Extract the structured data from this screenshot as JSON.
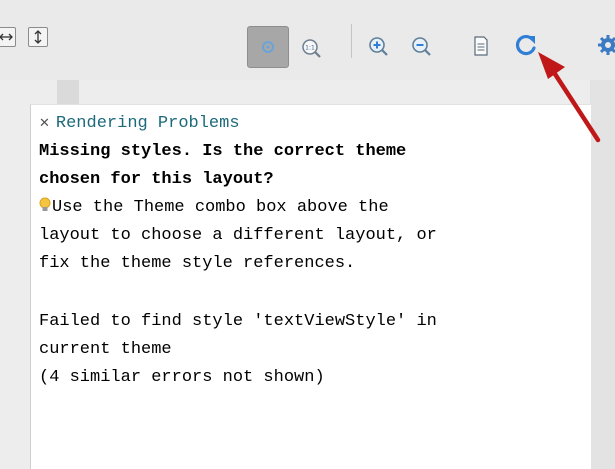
{
  "toolbar": {
    "icons": [
      "fit-width-icon",
      "fit-height-icon",
      "zoom-to-fit-icon",
      "zoom-actual-icon",
      "zoom-in-icon",
      "zoom-out-icon",
      "page-icon",
      "refresh-icon",
      "settings-icon"
    ],
    "accent_color": "#2f7fd6"
  },
  "panel": {
    "title": "Rendering Problems",
    "message_line1": "Missing styles. Is the correct theme",
    "message_line2": "chosen for this layout?",
    "hint_line1": "Use the Theme combo box above the",
    "hint_line2": "layout to choose a different layout, or",
    "hint_line3": "fix the theme style references.",
    "error_line1": "Failed to find style 'textViewStyle' in",
    "error_line2": "current theme",
    "error_line3": "(4 similar errors not shown)"
  },
  "annotation": {
    "arrow_color": "#c01818"
  }
}
